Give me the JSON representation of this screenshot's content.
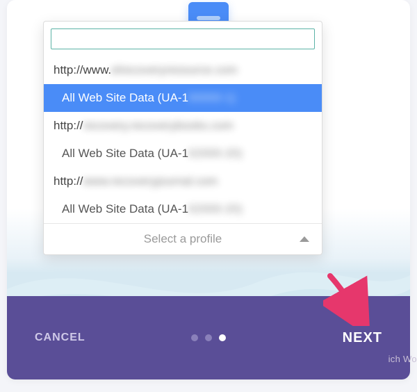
{
  "dropdown": {
    "search_value": "",
    "search_placeholder": "",
    "groups": [
      {
        "url_prefix": "http://www.",
        "url_obscured": "elrecoveryresource.com",
        "profile_label": "All Web Site Data (UA-1",
        "profile_obscured": "00000-1)",
        "selected": true
      },
      {
        "url_prefix": "http://",
        "url_obscured": "recovery.recoverybooks.com",
        "profile_label": "All Web Site Data (UA-1",
        "profile_obscured": "02000-20)",
        "selected": false
      },
      {
        "url_prefix": "http://",
        "url_obscured": "www.recoveryjournal.com",
        "profile_label": "All Web Site Data (UA-1",
        "profile_obscured": "02000-20)",
        "selected": false
      }
    ],
    "footer_label": "Select a profile"
  },
  "footer": {
    "cancel_label": "CANCEL",
    "next_label": "NEXT"
  },
  "pagination": {
    "total": 3,
    "active_index": 2
  },
  "background_hint": "ich WordPres"
}
